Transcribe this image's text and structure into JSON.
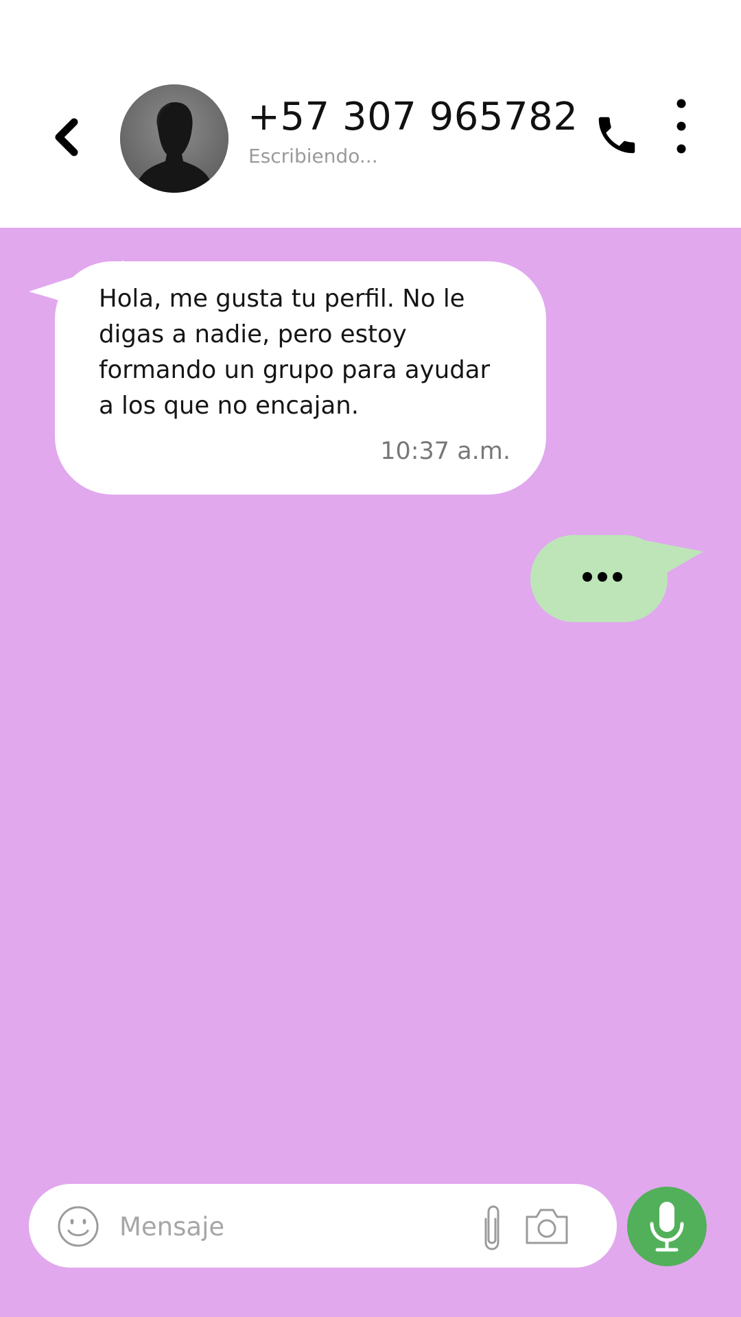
{
  "header": {
    "contact_name": "+57 307 965782",
    "status": "Escribiendo...",
    "back_icon": "chevron-left-icon",
    "call_icon": "phone-icon",
    "menu_icon": "more-vertical-icon",
    "avatar": "contact-silhouette-photo"
  },
  "messages": [
    {
      "direction": "incoming",
      "text": "Hola, me gusta tu perfil. No le digas a nadie, pero estoy formando un grupo para ayudar a los que no encajan.",
      "time": "10:37 a.m."
    },
    {
      "direction": "outgoing",
      "typing_indicator": true
    }
  ],
  "composer": {
    "placeholder": "Mensaje",
    "value": "",
    "emoji_icon": "smiley-icon",
    "attach_icon": "paperclip-icon",
    "camera_icon": "camera-icon",
    "mic_icon": "microphone-icon"
  },
  "colors": {
    "header_bg": "#ffffff",
    "chat_bg": "#e1a8ee",
    "incoming_bubble": "#ffffff",
    "outgoing_bubble": "#bde5b8",
    "mic_button": "#52b05a",
    "status_text": "#9a9a9a"
  }
}
